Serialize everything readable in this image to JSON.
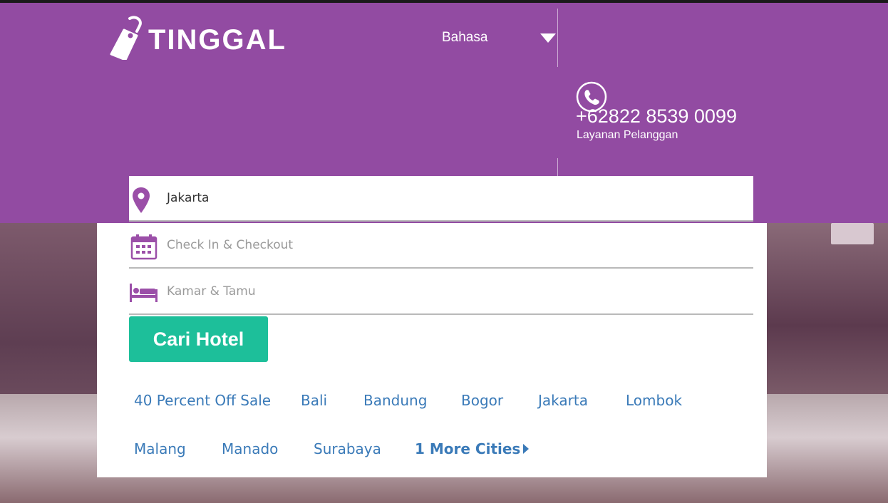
{
  "brand": {
    "name": "TINGGAL"
  },
  "header": {
    "language_label": "Bahasa",
    "phone_number": "+62822 8539 0099",
    "phone_caption": "Layanan Pelanggan"
  },
  "search": {
    "destination_value": "Jakarta",
    "checkin_placeholder": "Check In & Checkout",
    "guests_placeholder": "Kamar  & Tamu",
    "button_label": "Cari Hotel"
  },
  "cities": {
    "items": [
      "40 Percent Off Sale",
      "Bali",
      "Bandung",
      "Bogor",
      "Jakarta",
      "Lombok",
      "Malang",
      "Manado",
      "Surabaya"
    ],
    "more_label": "1 More Cities"
  },
  "colors": {
    "header_bg": "#924ba2",
    "accent_purple": "#9b4fa8",
    "button_green": "#1dbf9a",
    "link_blue": "#3a7ab8"
  },
  "icons": {
    "logo": "tag-icon",
    "language": "caret-down-icon",
    "phone": "phone-icon",
    "destination": "map-pin-icon",
    "checkin": "calendar-icon",
    "guests": "bed-icon",
    "more": "caret-right-icon"
  }
}
